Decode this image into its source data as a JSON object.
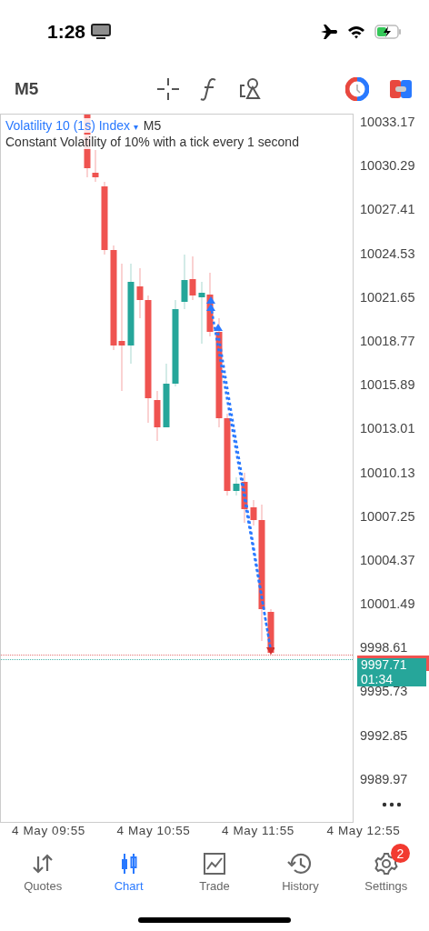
{
  "status_bar": {
    "time": "1:28"
  },
  "toolbar": {
    "timeframe": "M5"
  },
  "chart": {
    "symbol": "Volatility 10 (1s) Index",
    "dropdown": "▾",
    "timeframe": "M5",
    "description": "Constant Volatility of 10% with a tick every 1 second",
    "price_labels": [
      "10033.17",
      "10030.29",
      "10027.41",
      "10024.53",
      "10021.65",
      "10018.77",
      "10015.89",
      "10013.01",
      "10010.13",
      "10007.25",
      "10004.37",
      "10001.49",
      "9998.61",
      "9995.73",
      "9992.85",
      "9989.97"
    ],
    "current_price": "9997.71",
    "countdown": "01:34",
    "time_labels": [
      "4 May 09:55",
      "4 May 10:55",
      "4 May 11:55",
      "4 May 12:55"
    ]
  },
  "tabs": [
    {
      "kind": "quotes",
      "label": "Quotes",
      "selected": false
    },
    {
      "kind": "chart",
      "label": "Chart",
      "selected": true
    },
    {
      "kind": "trade",
      "label": "Trade",
      "selected": false
    },
    {
      "kind": "history",
      "label": "History",
      "selected": false
    },
    {
      "kind": "settings",
      "label": "Settings",
      "selected": false,
      "badge": "2"
    }
  ]
}
